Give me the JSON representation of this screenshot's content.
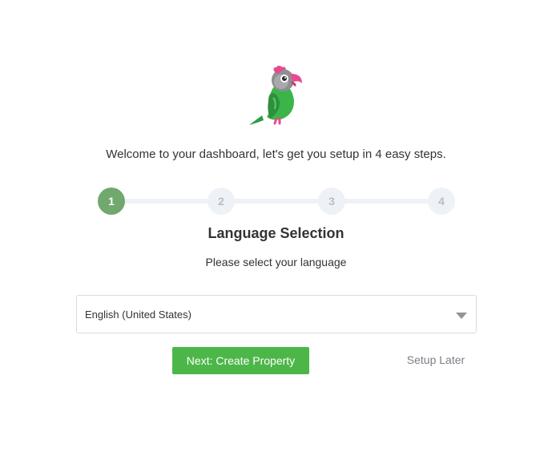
{
  "logo": {
    "icon": "parrot-logo-icon"
  },
  "welcome_text": "Welcome to your dashboard, let's get you setup in 4 easy steps.",
  "stepper": {
    "current_step": 1,
    "steps": [
      "1",
      "2",
      "3",
      "4"
    ],
    "active_color": "#70a86e",
    "inactive_color": "#eef2f6"
  },
  "section": {
    "title": "Language Selection",
    "subtitle": "Please select your language"
  },
  "language_select": {
    "value": "English (United States)",
    "icon": "chevron-down-icon"
  },
  "actions": {
    "next_label": "Next: Create Property",
    "next_color": "#4cb748",
    "later_label": "Setup Later"
  }
}
